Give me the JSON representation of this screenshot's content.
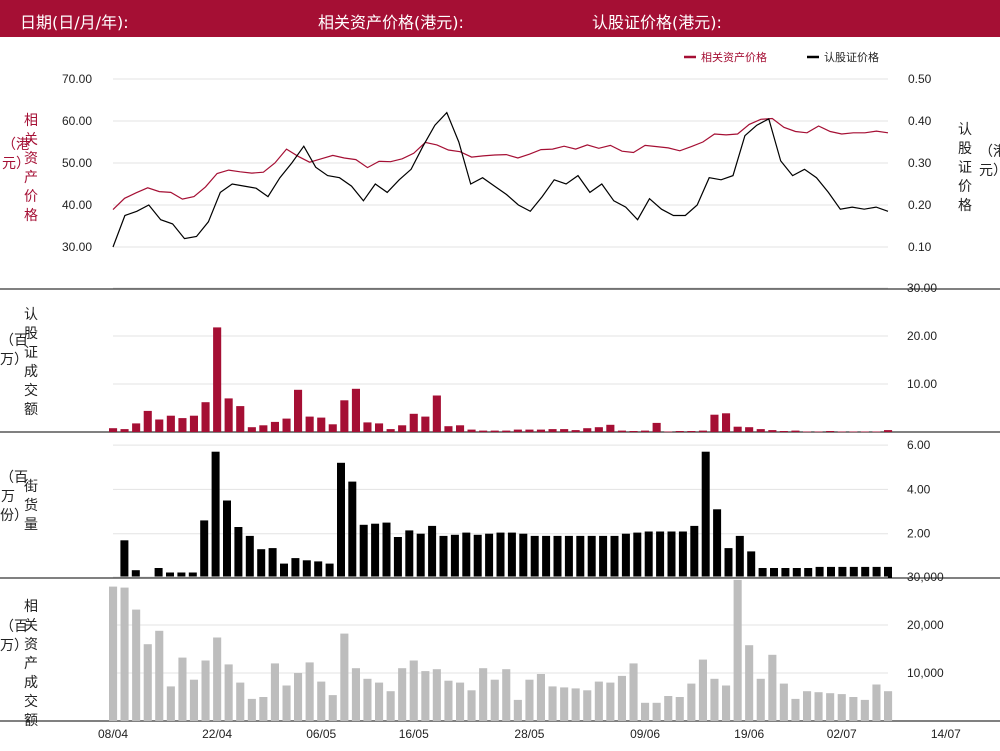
{
  "header": {
    "date_label": "日期(日/月/年):",
    "asset_price_label": "相关资产价格(港元):",
    "warrant_price_label": "认股证价格(港元):"
  },
  "legend": {
    "asset": "相关资产价格",
    "warrant": "认股证价格"
  },
  "axis_labels": {
    "left_price": "相关资产价格",
    "left_price_unit": "（港元）",
    "right_price": "认股证价格",
    "right_price_unit": "（港元）",
    "turnover": "认股证成交额",
    "turnover_unit": "（百万）",
    "outstanding": "街货量",
    "outstanding_unit": "（百万份）",
    "asset_turnover": "相关资产成交额",
    "asset_turnover_unit": "（百万）"
  },
  "colors": {
    "header": "#a50f34",
    "asset": "#a50f34",
    "warrant": "#000000",
    "turnover": "#a50f34",
    "outstanding": "#000000",
    "asset_turnover": "#bdbdbd"
  },
  "chart_data": [
    {
      "type": "line",
      "x_tick_labels": [
        "08/04",
        "22/04",
        "06/05",
        "16/05",
        "28/05",
        "09/06",
        "19/06",
        "02/07",
        "14/07"
      ],
      "x_tick_index": [
        0,
        9,
        18,
        26,
        36,
        46,
        55,
        63,
        72
      ],
      "ylim_left": [
        30,
        70
      ],
      "yticks_left": [
        "30.00",
        "40.00",
        "50.00",
        "60.00",
        "70.00"
      ],
      "ylim_right": [
        0.1,
        0.5
      ],
      "yticks_right": [
        "0.10",
        "0.20",
        "0.30",
        "0.40",
        "0.50"
      ],
      "series": [
        {
          "name": "相关资产价格",
          "axis": "left",
          "values": [
            38.9,
            41.6,
            42.9,
            44.1,
            43.2,
            43.0,
            41.4,
            42.0,
            44.3,
            47.5,
            48.3,
            47.9,
            47.6,
            47.8,
            50.0,
            53.3,
            51.6,
            50.2,
            51.0,
            51.8,
            51.2,
            50.8,
            48.9,
            50.4,
            50.3,
            51.0,
            52.3,
            54.9,
            54.3,
            53.1,
            52.7,
            51.4,
            51.7,
            51.9,
            52.0,
            51.2,
            52.1,
            53.2,
            53.3,
            54.0,
            53.3,
            54.3,
            53.5,
            54.2,
            52.8,
            52.5,
            54.2,
            53.9,
            53.6,
            52.9,
            53.9,
            55.0,
            56.9,
            56.7,
            56.9,
            59.2,
            60.4,
            60.6,
            58.5,
            57.5,
            57.2,
            58.8,
            57.5,
            56.9,
            57.2,
            57.2,
            57.6,
            57.2
          ]
        },
        {
          "name": "认股证价格",
          "axis": "right",
          "values": [
            0.1,
            0.175,
            0.185,
            0.2,
            0.165,
            0.155,
            0.12,
            0.125,
            0.16,
            0.23,
            0.25,
            0.245,
            0.24,
            0.22,
            0.265,
            0.3,
            0.34,
            0.29,
            0.27,
            0.265,
            0.245,
            0.21,
            0.25,
            0.23,
            0.26,
            0.285,
            0.34,
            0.39,
            0.42,
            0.35,
            0.25,
            0.265,
            0.245,
            0.225,
            0.2,
            0.185,
            0.22,
            0.26,
            0.25,
            0.27,
            0.23,
            0.25,
            0.21,
            0.195,
            0.165,
            0.215,
            0.19,
            0.175,
            0.175,
            0.2,
            0.265,
            0.26,
            0.27,
            0.365,
            0.39,
            0.405,
            0.305,
            0.27,
            0.285,
            0.265,
            0.23,
            0.19,
            0.195,
            0.19,
            0.195,
            0.185
          ]
        }
      ]
    },
    {
      "type": "bar",
      "name": "认股证成交额",
      "unit": "百万",
      "ylim": [
        0,
        30
      ],
      "yticks": [
        "10.00",
        "20.00",
        "30.00"
      ],
      "values": [
        0.8,
        0.6,
        1.8,
        4.4,
        2.6,
        3.4,
        2.9,
        3.4,
        6.2,
        21.8,
        7.0,
        5.4,
        1.0,
        1.4,
        2.1,
        2.8,
        8.8,
        3.2,
        3.0,
        1.6,
        6.6,
        9.0,
        2.0,
        1.8,
        0.6,
        1.4,
        3.8,
        3.2,
        7.6,
        1.2,
        1.4,
        0.5,
        0.3,
        0.3,
        0.3,
        0.5,
        0.5,
        0.5,
        0.6,
        0.6,
        0.4,
        0.8,
        1.0,
        1.5,
        0.3,
        0.2,
        0.3,
        1.9,
        0.1,
        0.2,
        0.2,
        0.3,
        3.6,
        3.9,
        1.1,
        1.0,
        0.6,
        0.4,
        0.2,
        0.3,
        0.1,
        0.1,
        0.2,
        0.1,
        0.1,
        0.1,
        0.1,
        0.4
      ]
    },
    {
      "type": "bar",
      "name": "街货量",
      "unit": "百万份",
      "ylim": [
        0,
        6.5
      ],
      "yticks": [
        "2.00",
        "4.00",
        "6.00"
      ],
      "values": [
        0,
        1.7,
        0.35,
        0,
        0.45,
        0.25,
        0.25,
        0.25,
        2.6,
        5.7,
        3.5,
        2.3,
        1.9,
        1.3,
        1.35,
        0.65,
        0.9,
        0.8,
        0.75,
        0.65,
        5.2,
        4.35,
        2.4,
        2.45,
        2.5,
        1.85,
        2.15,
        2.0,
        2.35,
        1.9,
        1.95,
        2.05,
        1.95,
        2.0,
        2.05,
        2.05,
        2.0,
        1.9,
        1.9,
        1.9,
        1.9,
        1.9,
        1.9,
        1.9,
        1.9,
        2.0,
        2.05,
        2.1,
        2.1,
        2.1,
        2.1,
        2.35,
        5.7,
        3.1,
        1.35,
        1.9,
        1.2,
        0.45,
        0.45,
        0.45,
        0.45,
        0.45,
        0.5,
        0.5,
        0.5,
        0.5,
        0.5,
        0.5,
        0.5
      ]
    },
    {
      "type": "bar",
      "name": "相关资产成交额",
      "unit": "百万",
      "ylim": [
        0,
        30000
      ],
      "yticks": [
        "10,000",
        "20,000",
        "30,000"
      ],
      "values": [
        28000,
        27800,
        23200,
        16000,
        18800,
        7200,
        13200,
        8600,
        12600,
        17400,
        11800,
        8000,
        4600,
        5000,
        12000,
        7400,
        10000,
        12200,
        8200,
        5400,
        18200,
        11000,
        8800,
        8000,
        6200,
        11000,
        12600,
        10400,
        10800,
        8400,
        8000,
        6400,
        11000,
        8600,
        10800,
        4400,
        8600,
        9800,
        7200,
        7000,
        6800,
        6400,
        8200,
        8000,
        9400,
        12000,
        3800,
        3800,
        5200,
        5000,
        7800,
        12800,
        8800,
        7400,
        29400,
        15800,
        8800,
        13800,
        7800,
        4600,
        6200,
        6000,
        5800,
        5600,
        5000,
        4400,
        7600,
        6200
      ]
    }
  ]
}
